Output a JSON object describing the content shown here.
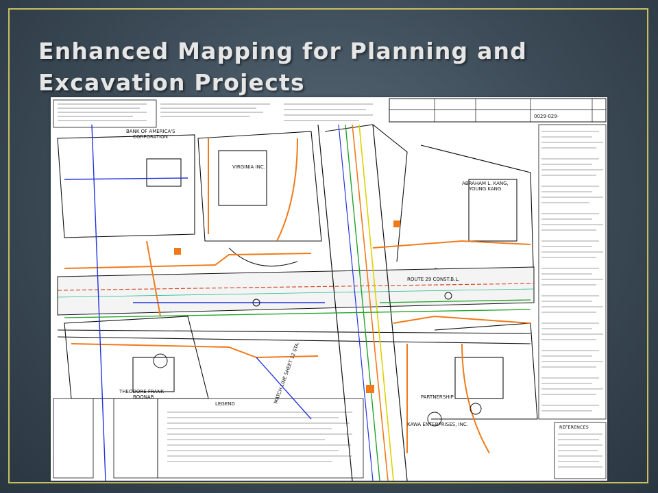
{
  "slide": {
    "title": "Enhanced Mapping for Planning and Excavation Projects"
  },
  "map": {
    "labels": {
      "bank": "BANK OF AMERICA'S",
      "corp": "CORPORATION",
      "virginia": "VIRGINIA INC.",
      "kang": "ABRAHAM L. KANG,",
      "young": "YOUNG KANG",
      "route29": "ROUTE 29 CONST.B.L.",
      "theodore": "THEODORE FRANK",
      "boonar": "BOONAR",
      "kawa": "KAWA ENTERPRISES, INC.",
      "partnership": "PARTNERSHIP",
      "legend": "LEGEND",
      "references": "REFERENCES",
      "match_line": "MATCH LINE SHEET 12 STA.",
      "sheet_no": "0029-029-"
    },
    "colors": {
      "orange": "#f07a1a",
      "blue": "#2233dd",
      "green": "#1fa32a",
      "yellow": "#e0d000",
      "ink": "#111111"
    }
  }
}
